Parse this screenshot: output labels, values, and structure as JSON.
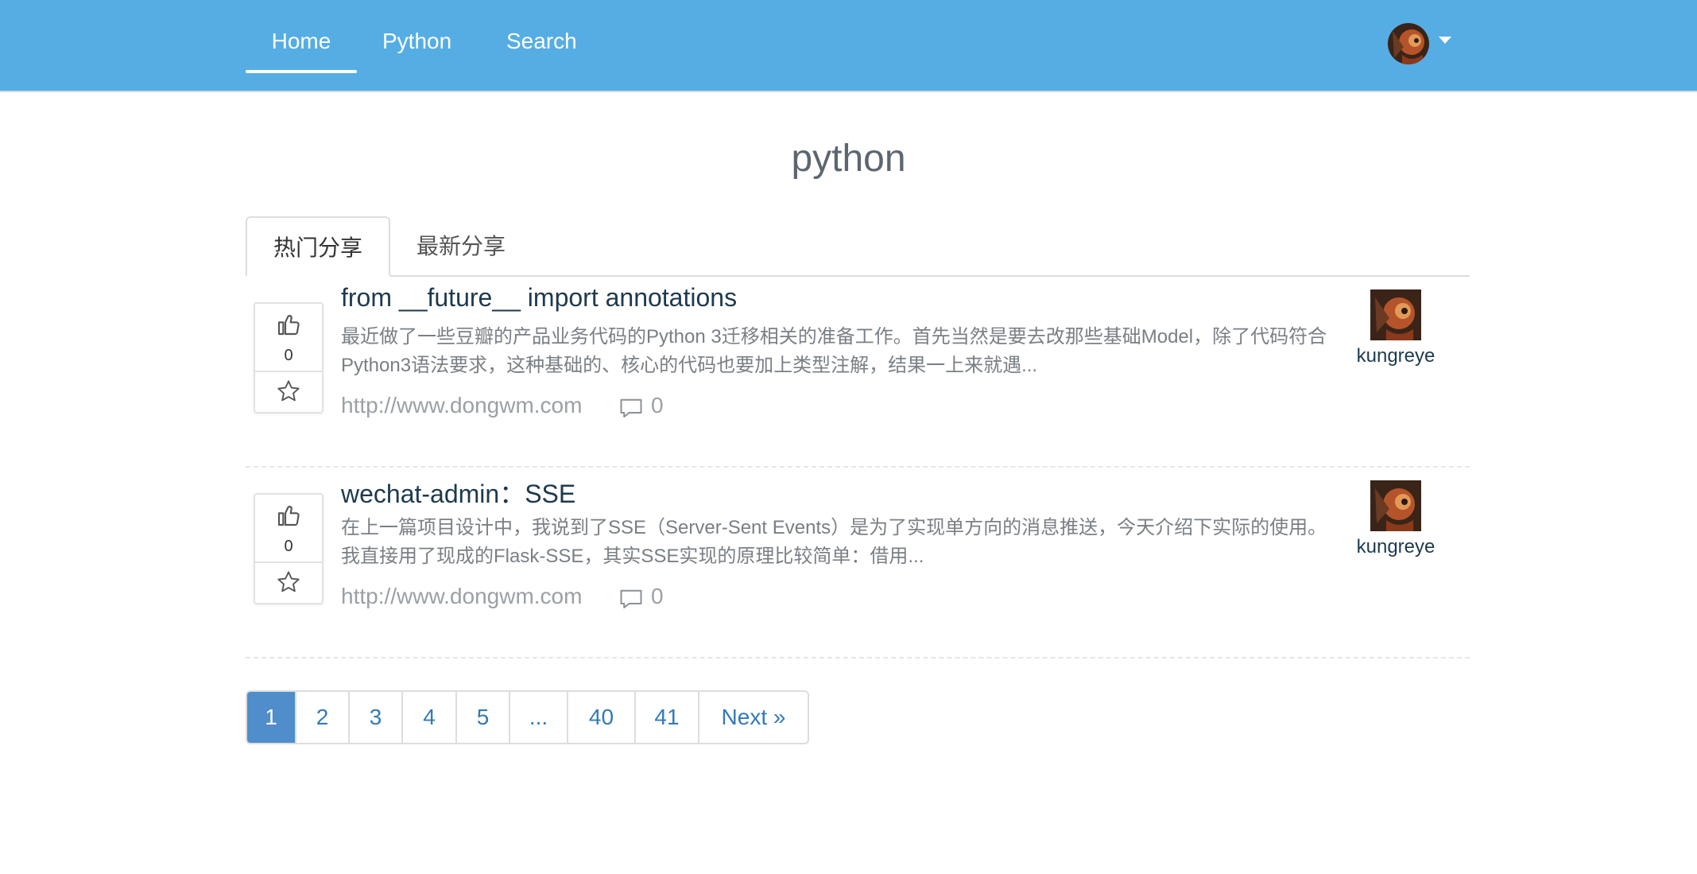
{
  "nav": {
    "items": [
      {
        "label": "Home",
        "active": true
      },
      {
        "label": "Python",
        "active": false
      },
      {
        "label": "Search",
        "active": false
      }
    ]
  },
  "page_title": "python",
  "tabs": [
    {
      "label": "热门分享",
      "active": true
    },
    {
      "label": "最新分享",
      "active": false
    }
  ],
  "posts": [
    {
      "votes": "0",
      "title": "from __future__ import annotations",
      "summary": "最近做了一些豆瓣的产品业务代码的Python 3迁移相关的准备工作。首先当然是要去改那些基础Model，除了代码符合Python3语法要求，这种基础的、核心的代码也要加上类型注解，结果一上来就遇...",
      "link": "http://www.dongwm.com",
      "comments": "0",
      "author": "kungreye"
    },
    {
      "votes": "0",
      "title": "wechat-admin：SSE",
      "summary": "在上一篇项目设计中，我说到了SSE（Server-Sent Events）是为了实现单方向的消息推送，今天介绍下实际的使用。我直接用了现成的Flask-SSE，其实SSE实现的原理比较简单：借用...",
      "link": "http://www.dongwm.com",
      "comments": "0",
      "author": "kungreye"
    }
  ],
  "pagination": {
    "pages": [
      "1",
      "2",
      "3",
      "4",
      "5",
      "...",
      "40",
      "41",
      "Next »"
    ],
    "active": "1"
  },
  "colors": {
    "navbar": "#55ade4",
    "title": "#5d6670",
    "link": "#337ab7",
    "active_page": "#4f8dcb"
  }
}
